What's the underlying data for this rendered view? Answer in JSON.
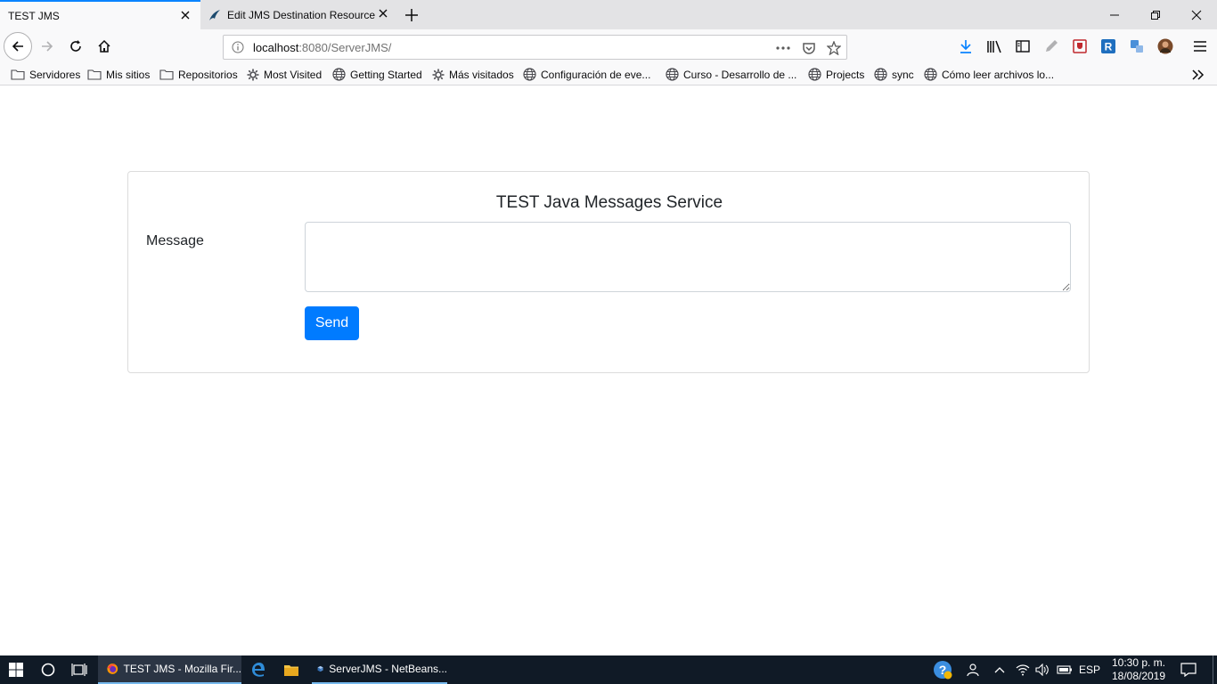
{
  "browser": {
    "tabs": [
      {
        "title": "TEST JMS"
      },
      {
        "title": "Edit JMS Destination Resource"
      }
    ],
    "url_host": "localhost",
    "url_rest": ":8080/ServerJMS/",
    "bookmarks": [
      {
        "label": "Servidores",
        "icon": "folder-icon"
      },
      {
        "label": "Mis sitios",
        "icon": "folder-icon"
      },
      {
        "label": "Repositorios",
        "icon": "folder-icon"
      },
      {
        "label": "Most Visited",
        "icon": "gear-icon"
      },
      {
        "label": "Getting Started",
        "icon": "globe-icon"
      },
      {
        "label": "Más visitados",
        "icon": "gear-icon"
      },
      {
        "label": "Configuración de eve...",
        "icon": "globe-icon"
      },
      {
        "label": "Curso - Desarrollo de ...",
        "icon": "globe-icon"
      },
      {
        "label": "Projects",
        "icon": "globe-icon"
      },
      {
        "label": "sync",
        "icon": "globe-icon"
      },
      {
        "label": "Cómo leer archivos lo...",
        "icon": "globe-icon"
      }
    ],
    "toolbar_badge": "R"
  },
  "page": {
    "title": "TEST Java Messages Service",
    "message_label": "Message",
    "message_value": "",
    "send_label": "Send",
    "accent_color": "#007bff"
  },
  "taskbar": {
    "items": [
      {
        "label": "TEST JMS - Mozilla Fir..."
      },
      {
        "label": "ServerJMS - NetBeans..."
      }
    ],
    "language": "ESP",
    "time": "10:30 p. m.",
    "date": "18/08/2019"
  }
}
